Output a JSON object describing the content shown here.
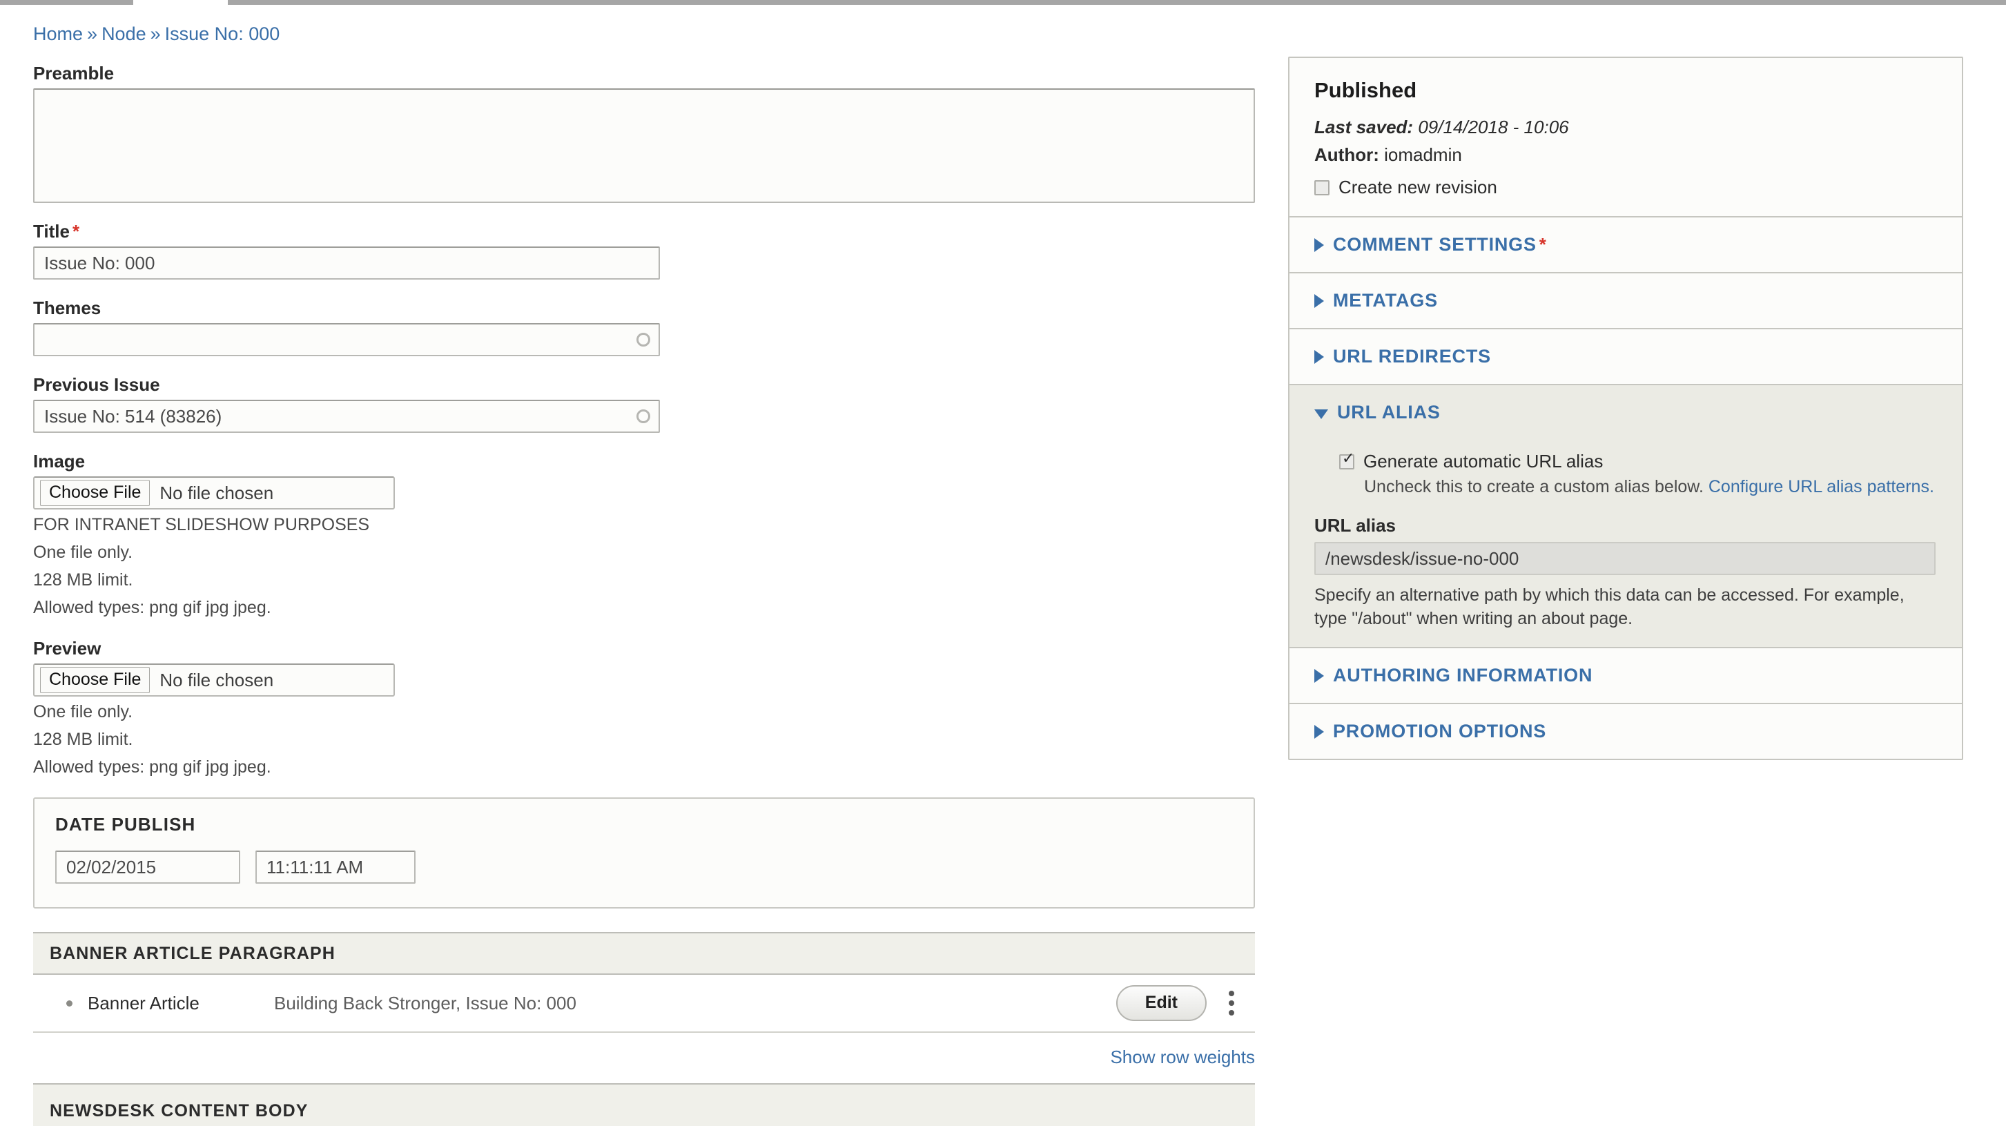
{
  "breadcrumb": {
    "items": [
      {
        "label": "Home"
      },
      {
        "label": "Node"
      },
      {
        "label": "Issue No: 000"
      }
    ],
    "separator": "»"
  },
  "form": {
    "preamble": {
      "label": "Preamble",
      "value": ""
    },
    "title": {
      "label": "Title",
      "required_marker": "*",
      "value": "Issue No: 000"
    },
    "themes": {
      "label": "Themes",
      "value": "",
      "throbber": "circle-throbber-icon"
    },
    "previous_issue": {
      "label": "Previous Issue",
      "value": "Issue No: 514 (83826)",
      "throbber": "circle-throbber-icon"
    },
    "image": {
      "label": "Image",
      "choose_label": "Choose File",
      "no_file_text": "No file chosen",
      "help": [
        "FOR INTRANET SLIDESHOW PURPOSES",
        "One file only.",
        "128 MB limit.",
        "Allowed types: png gif jpg jpeg."
      ]
    },
    "preview": {
      "label": "Preview",
      "choose_label": "Choose File",
      "no_file_text": "No file chosen",
      "help": [
        "One file only.",
        "128 MB limit.",
        "Allowed types: png gif jpg jpeg."
      ]
    },
    "date_publish": {
      "legend": "DATE PUBLISH",
      "date_value": "02/02/2015",
      "time_value": "11:11:11 AM"
    }
  },
  "paragraphs": {
    "banner": {
      "header": "BANNER ARTICLE PARAGRAPH",
      "rows": [
        {
          "type": "Banner Article",
          "summary": "Building Back Stronger, Issue No: 000",
          "edit_label": "Edit",
          "menu_icon": "kebab-menu-icon"
        }
      ],
      "show_row_weights": "Show row weights"
    },
    "content_body": {
      "header": "NEWSDESK CONTENT BODY"
    }
  },
  "sidebar": {
    "status": {
      "title": "Published",
      "last_saved_label": "Last saved:",
      "last_saved_value": "09/14/2018 - 10:06",
      "author_label": "Author:",
      "author_value": "iomadmin",
      "create_revision_label": "Create new revision",
      "create_revision_checked": false
    },
    "sections": [
      {
        "title": "COMMENT SETTINGS",
        "required_marker": "*",
        "expanded": false,
        "icon": "chevron-right-icon"
      },
      {
        "title": "METATAGS",
        "expanded": false,
        "icon": "chevron-right-icon"
      },
      {
        "title": "URL REDIRECTS",
        "expanded": false,
        "icon": "chevron-right-icon"
      },
      {
        "title": "URL ALIAS",
        "expanded": true,
        "icon": "chevron-down-icon"
      },
      {
        "title": "AUTHORING INFORMATION",
        "expanded": false,
        "icon": "chevron-right-icon"
      },
      {
        "title": "PROMOTION OPTIONS",
        "expanded": false,
        "icon": "chevron-right-icon"
      }
    ],
    "url_alias": {
      "generate_label": "Generate automatic URL alias",
      "generate_checked": true,
      "hint_text": "Uncheck this to create a custom alias below.",
      "hint_link": "Configure URL alias patterns.",
      "alias_label": "URL alias",
      "alias_value": "/newsdesk/issue-no-000",
      "description": "Specify an alternative path by which this data can be accessed. For example, type \"/about\" when writing an about page."
    }
  },
  "colors": {
    "link": "#3a6fa8",
    "required": "#d7342a",
    "panel_open_bg": "#ebebe4",
    "table_header_bg": "#f0f0ea"
  }
}
